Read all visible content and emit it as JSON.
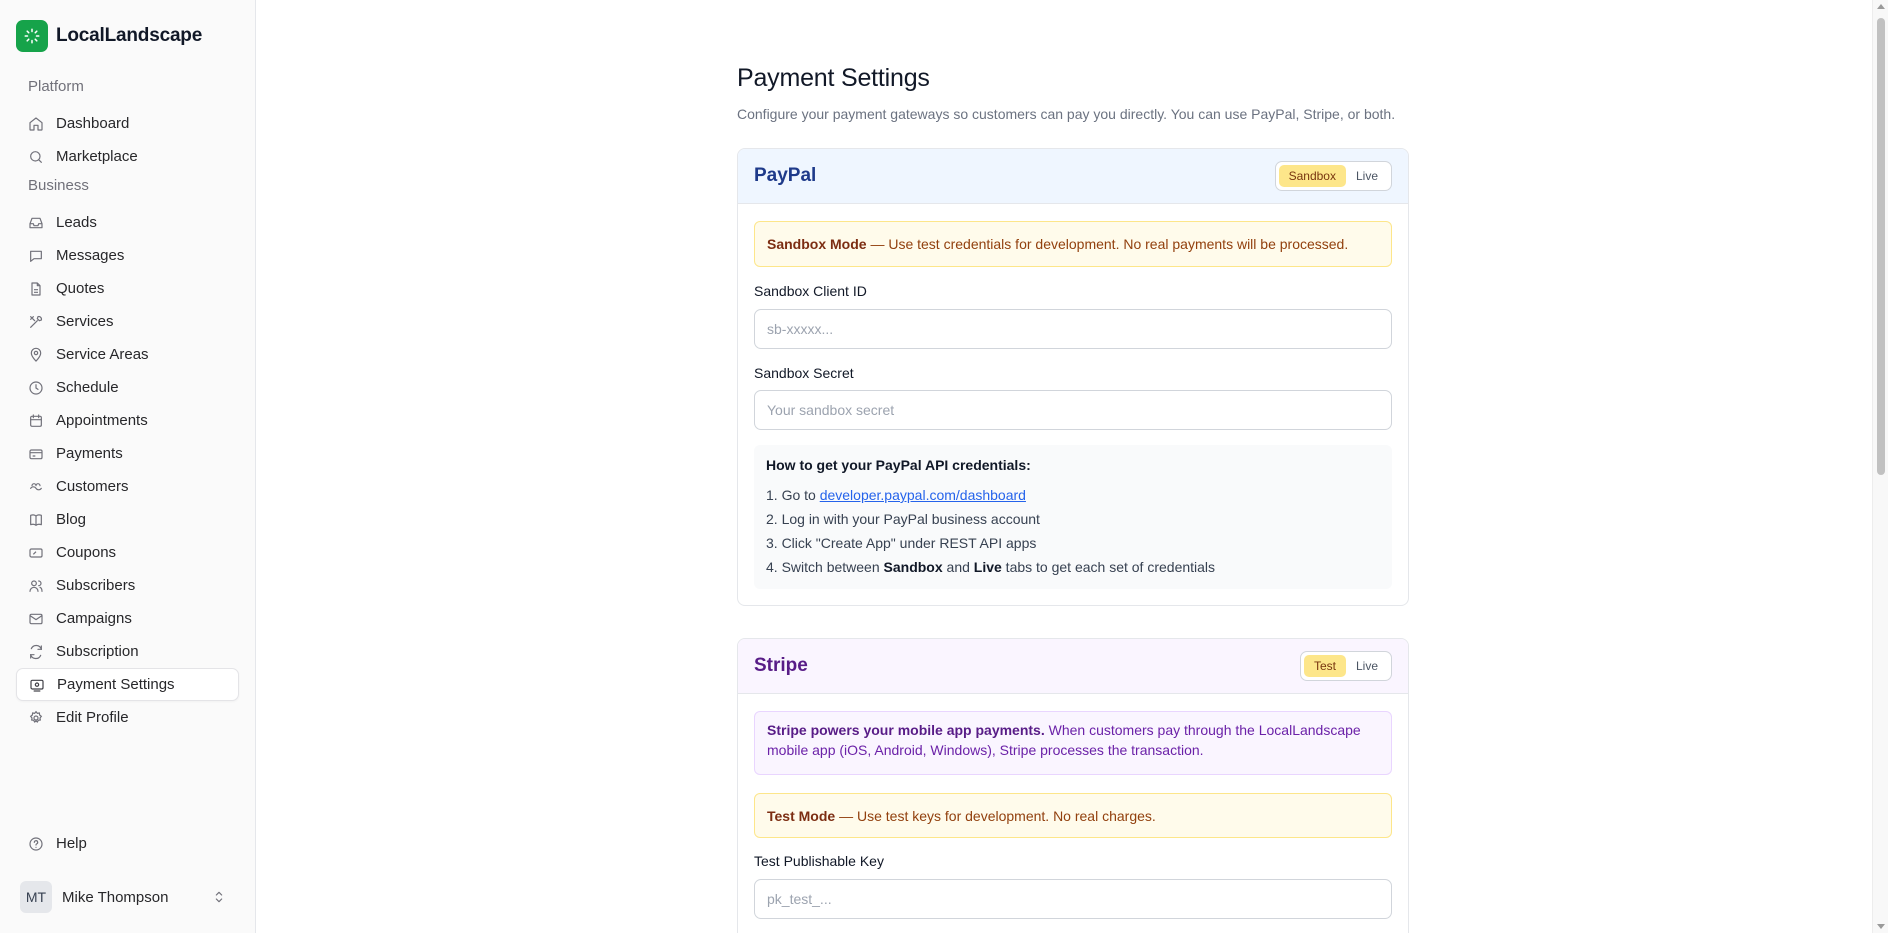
{
  "app": {
    "name": "LocalLandscape"
  },
  "sidebar": {
    "platform_label": "Platform",
    "platform_items": [
      {
        "label": "Dashboard",
        "icon": "home-icon"
      },
      {
        "label": "Marketplace",
        "icon": "search-icon"
      }
    ],
    "business_label": "Business",
    "business_items": [
      {
        "label": "Leads",
        "icon": "inbox-icon"
      },
      {
        "label": "Messages",
        "icon": "chat-icon"
      },
      {
        "label": "Quotes",
        "icon": "file-icon"
      },
      {
        "label": "Services",
        "icon": "tools-icon"
      },
      {
        "label": "Service Areas",
        "icon": "map-pin-icon"
      },
      {
        "label": "Schedule",
        "icon": "clock-icon"
      },
      {
        "label": "Appointments",
        "icon": "calendar-icon"
      },
      {
        "label": "Payments",
        "icon": "credit-card-icon"
      },
      {
        "label": "Customers",
        "icon": "customers-icon"
      },
      {
        "label": "Blog",
        "icon": "book-icon"
      },
      {
        "label": "Coupons",
        "icon": "coupon-icon"
      },
      {
        "label": "Subscribers",
        "icon": "users-icon"
      },
      {
        "label": "Campaigns",
        "icon": "mail-icon"
      },
      {
        "label": "Subscription",
        "icon": "refresh-icon"
      },
      {
        "label": "Payment Settings",
        "icon": "payment-settings-icon",
        "active": true
      },
      {
        "label": "Edit Profile",
        "icon": "gear-icon"
      }
    ],
    "help_label": "Help",
    "user": {
      "initials": "MT",
      "name": "Mike Thompson"
    }
  },
  "page": {
    "title": "Payment Settings",
    "description": "Configure your payment gateways so customers can pay you directly. You can use PayPal, Stripe, or both."
  },
  "paypal": {
    "title": "PayPal",
    "mode_options": [
      "Sandbox",
      "Live"
    ],
    "selected_mode": "Sandbox",
    "alert_bold": "Sandbox Mode",
    "alert_text": " — Use test credentials for development. No real payments will be processed.",
    "client_id_label": "Sandbox Client ID",
    "client_id_placeholder": "sb-xxxxx...",
    "client_id_value": "",
    "secret_label": "Sandbox Secret",
    "secret_placeholder": "Your sandbox secret",
    "secret_value": "",
    "howto_title": "How to get your PayPal API credentials:",
    "steps": {
      "s1_prefix": "1. Go to ",
      "s1_link": "developer.paypal.com/dashboard",
      "s2": "2. Log in with your PayPal business account",
      "s3": "3. Click \"Create App\" under REST API apps",
      "s4_prefix": "4. Switch between ",
      "s4_b1": "Sandbox",
      "s4_mid": " and ",
      "s4_b2": "Live",
      "s4_suffix": " tabs to get each set of credentials"
    }
  },
  "stripe": {
    "title": "Stripe",
    "mode_options": [
      "Test",
      "Live"
    ],
    "selected_mode": "Test",
    "info_bold": "Stripe powers your mobile app payments.",
    "info_text": " When customers pay through the LocalLandscape mobile app (iOS, Android, Windows), Stripe processes the transaction.",
    "alert_bold": "Test Mode",
    "alert_text": " — Use test keys for development. No real charges.",
    "publishable_label": "Test Publishable Key",
    "publishable_placeholder": "pk_test_...",
    "publishable_value": ""
  },
  "colors": {
    "brand": "#16a34a",
    "paypal_title": "#1e3a8a",
    "stripe_title": "#581c87",
    "toggle_active": "#fde68a"
  }
}
